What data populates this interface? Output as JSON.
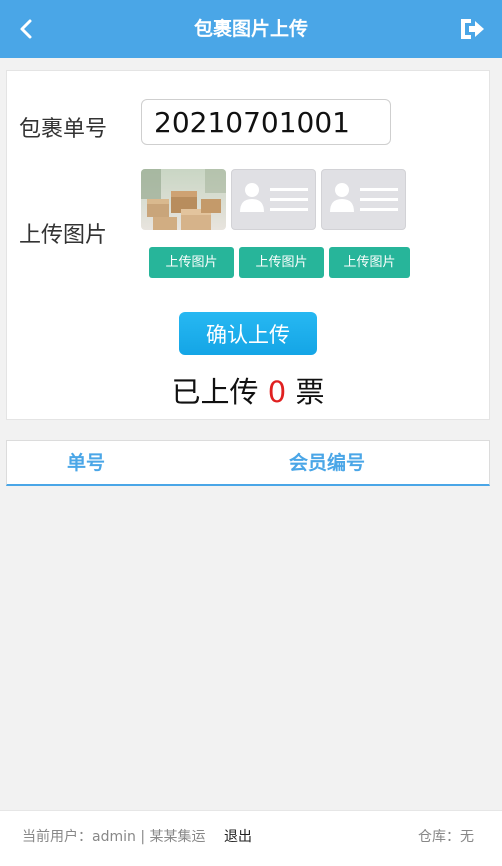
{
  "header": {
    "title": "包裹图片上传",
    "back_icon": "chevron-left-icon",
    "exit_icon": "sign-out-icon",
    "background_color": "#4aa6e7"
  },
  "form": {
    "order_label": "包裹单号",
    "order_value": "20210701001",
    "image_label": "上传图片",
    "images": [
      {
        "state": "photo-of-boxes"
      },
      {
        "state": "placeholder",
        "icon": "id-card-placeholder-icon"
      },
      {
        "state": "placeholder",
        "icon": "id-card-placeholder-icon"
      }
    ],
    "upload_buttons": [
      "上传图片",
      "上传图片",
      "上传图片"
    ],
    "confirm_label": "确认上传",
    "count_prefix": "已上传",
    "count_value": "0",
    "count_suffix": "票"
  },
  "table": {
    "columns": [
      "单号",
      "会员编号"
    ],
    "rows": []
  },
  "footer": {
    "user_text": "当前用户：admin | 某某集运",
    "logout_label": "退出",
    "warehouse_text": "仓库：无"
  },
  "colors": {
    "accent": "#4aa6e7",
    "upload_button": "#27b59a",
    "confirm_button": "#1fb2ee",
    "count_highlight": "#e02020"
  }
}
